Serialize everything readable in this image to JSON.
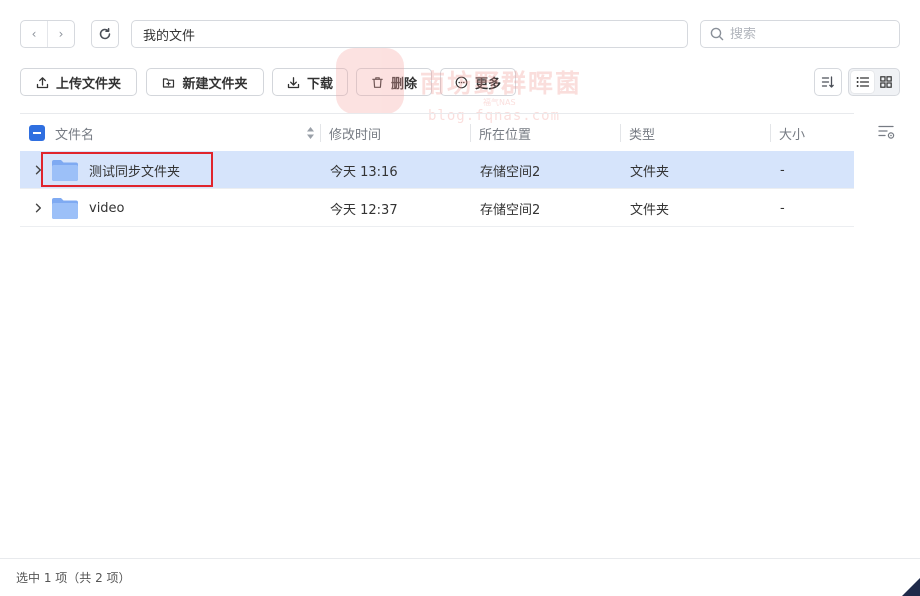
{
  "nav": {
    "back_glyph": "‹",
    "forward_glyph": "›",
    "path": "我的文件",
    "search_placeholder": "搜索"
  },
  "toolbar": {
    "upload_folder": "上传文件夹",
    "new_folder": "新建文件夹",
    "download": "下载",
    "delete": "删除",
    "more": "更多"
  },
  "table": {
    "columns": {
      "name": "文件名",
      "modified": "修改时间",
      "location": "所在位置",
      "type": "类型",
      "size": "大小"
    },
    "rows": [
      {
        "name": "测试同步文件夹",
        "modified": "今天 13:16",
        "location": "存储空间2",
        "type": "文件夹",
        "size": "-",
        "selected": true
      },
      {
        "name": "video",
        "modified": "今天 12:37",
        "location": "存储空间2",
        "type": "文件夹",
        "size": "-",
        "selected": false
      }
    ]
  },
  "watermark": {
    "title": "南坊野群晖菌",
    "sub": "福气NAS",
    "url": "blog.fqnas.com"
  },
  "status": {
    "text": "选中 1 项（共 2 项）"
  },
  "colors": {
    "accent": "#2f6fe0",
    "selected_row": "#d6e4fb",
    "highlight": "#e0242c",
    "folder": "#8db4f5"
  },
  "view": {
    "mode": "list"
  }
}
